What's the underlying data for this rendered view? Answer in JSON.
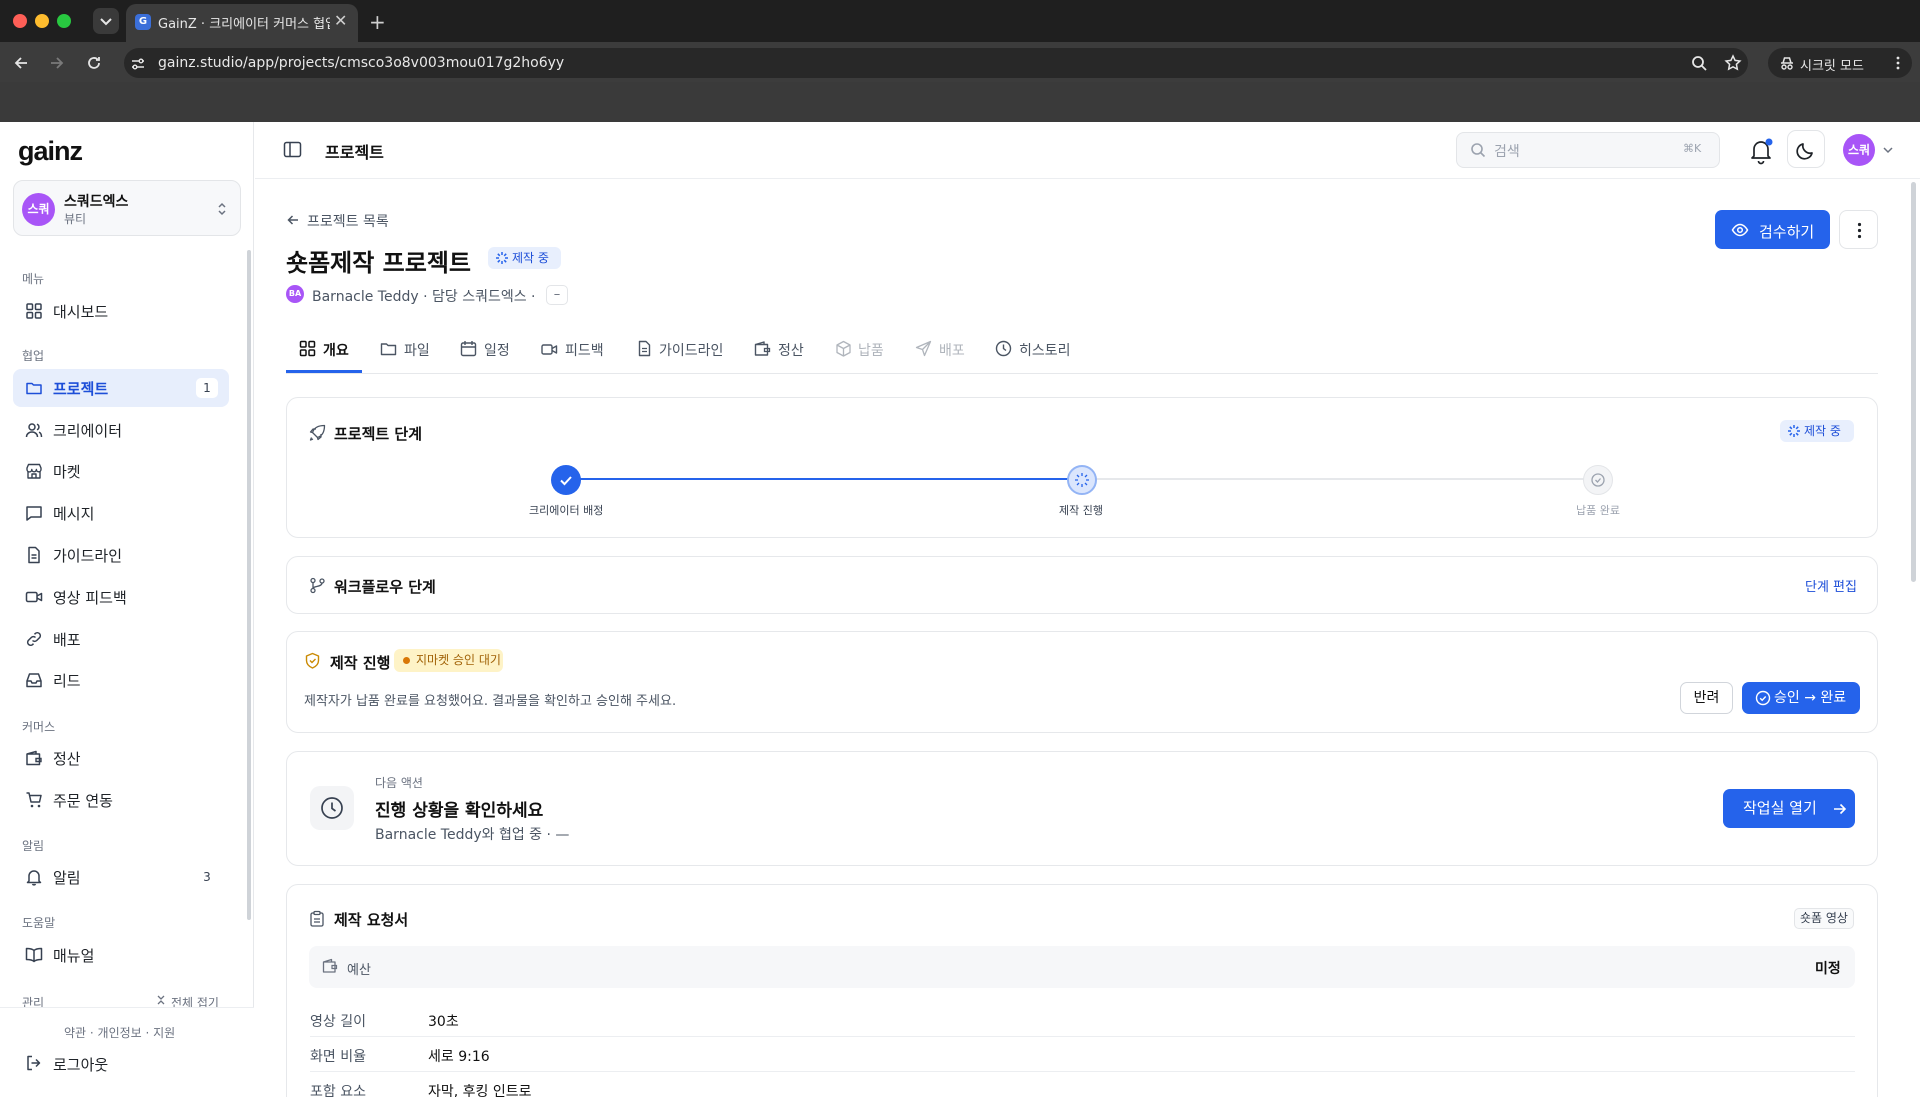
{
  "browser": {
    "tab_title": "GainZ · 크리에이터 커머스 협업 C",
    "tab_favicon": "G",
    "url": "gainz.studio/app/projects/cmsco3o8v003mou017g2ho6yy",
    "incognito_label": "시크릿 모드"
  },
  "sidebar": {
    "logo": "gainz",
    "workspace": {
      "avatar": "스쿼",
      "name": "스쿼드엑스",
      "category": "뷰티"
    },
    "sections": {
      "menu": "메뉴",
      "collab": "협업",
      "commerce": "커머스",
      "alerts": "알림",
      "help": "도움말",
      "admin": "관리"
    },
    "items": {
      "dashboard": "대시보드",
      "projects": "프로젝트",
      "projects_count": "1",
      "creators": "크리에이터",
      "market": "마켓",
      "messages": "메시지",
      "guidelines": "가이드라인",
      "video_feedback": "영상 피드백",
      "distribution": "배포",
      "leads": "리드",
      "settlement": "정산",
      "order_sync": "주문 연동",
      "notifications": "알림",
      "notifications_count": "3",
      "manual": "매뉴얼"
    },
    "collapse_all": "전체 접기",
    "footer_links": "약관  ·  개인정보  ·  지원",
    "logout": "로그아웃"
  },
  "header": {
    "title": "프로젝트",
    "search_placeholder": "검색",
    "search_shortcut": "⌘K",
    "user_avatar": "스쿼"
  },
  "project": {
    "back_link": "프로젝트 목록",
    "title": "숏폼제작 프로젝트",
    "status": "제작 중",
    "creator_avatar": "BA",
    "meta": "Barnacle Teddy  ·  담당 스쿼드엑스  ·",
    "meta_extra": "–",
    "review_button": "검수하기"
  },
  "tabs": {
    "overview": "개요",
    "files": "파일",
    "schedule": "일정",
    "feedback": "피드백",
    "guideline": "가이드라인",
    "settlement": "정산",
    "delivery": "납품",
    "distribution": "배포",
    "history": "히스토리"
  },
  "stages": {
    "title": "프로젝트 단계",
    "status": "제작 중",
    "steps": [
      "크리에이터 배정",
      "제작 진행",
      "납품 완료"
    ]
  },
  "workflow": {
    "title": "워크플로우 단계",
    "edit": "단계 편집"
  },
  "production": {
    "title": "제작 진행",
    "badge": "지마켓 승인 대기",
    "text": "제작자가 납품 완료를 요청했어요. 결과물을 확인하고 승인해 주세요.",
    "reject": "반려",
    "approve": "승인 → 완료"
  },
  "next_action": {
    "label": "다음 액션",
    "title": "진행 상황을 확인하세요",
    "subtitle": "Barnacle Teddy와 협업 중 · —",
    "button": "작업실 열기"
  },
  "request": {
    "title": "제작 요청서",
    "badge": "숏폼 영상",
    "budget_label": "예산",
    "budget_value": "미정",
    "rows": [
      {
        "key": "영상 길이",
        "value": "30초"
      },
      {
        "key": "화면 비율",
        "value": "세로 9:16"
      },
      {
        "key": "포함 요소",
        "value": "자막, 후킹 인트로"
      }
    ]
  },
  "colors": {
    "accent": "#2563eb",
    "avatar": "#a855f7",
    "warn": "#d97706"
  }
}
